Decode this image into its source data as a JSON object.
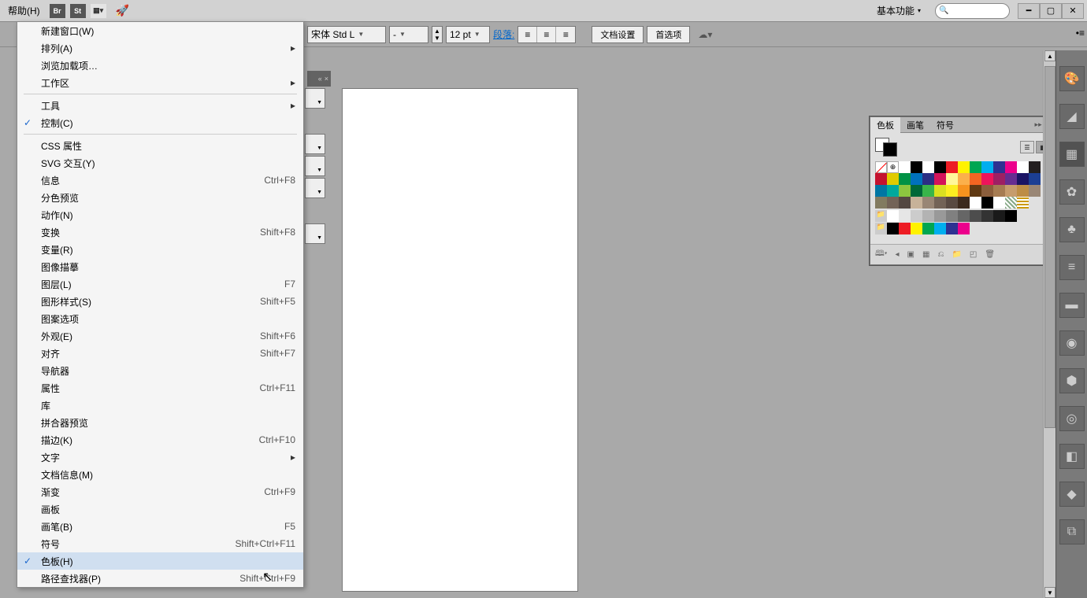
{
  "topbar": {
    "help": "帮助(H)",
    "workspace": "基本功能",
    "minimize": "━",
    "maximize": "▢",
    "close": "✕"
  },
  "options": {
    "font": "宋体 Std L",
    "fontStyle": "-",
    "size": "12 pt",
    "para": "段落:",
    "docSetup": "文档设置",
    "preferences": "首选项"
  },
  "menu": {
    "newWindow": "新建窗口(W)",
    "arrange": "排列(A)",
    "browseAddons": "浏览加载项…",
    "workspace": "工作区",
    "tools": "工具",
    "control": "控制(C)",
    "cssProps": "CSS 属性",
    "svgInteract": "SVG 交互(Y)",
    "info": "信息",
    "infoKey": "Ctrl+F8",
    "sepPrev": "分色预览",
    "actions": "动作(N)",
    "transform": "变换",
    "transformKey": "Shift+F8",
    "variables": "变量(R)",
    "imageTrace": "图像描摹",
    "layers": "图层(L)",
    "layersKey": "F7",
    "graphicStyles": "图形样式(S)",
    "graphicStylesKey": "Shift+F5",
    "patternOpts": "图案选项",
    "appearance": "外观(E)",
    "appearanceKey": "Shift+F6",
    "align": "对齐",
    "alignKey": "Shift+F7",
    "navigator": "导航器",
    "attributes": "属性",
    "attributesKey": "Ctrl+F11",
    "libraries": "库",
    "flattener": "拼合器预览",
    "stroke": "描边(K)",
    "strokeKey": "Ctrl+F10",
    "type": "文字",
    "docInfo": "文档信息(M)",
    "gradient": "渐变",
    "gradientKey": "Ctrl+F9",
    "artboards": "画板",
    "brushes": "画笔(B)",
    "brushesKey": "F5",
    "symbols": "符号",
    "symbolsKey": "Shift+Ctrl+F11",
    "swatches": "色板(H)",
    "pathfinder": "路径查找器(P)",
    "pathfinderKey": "Shift+Ctrl+F9"
  },
  "panel": {
    "tab1": "色板",
    "tab2": "画笔",
    "tab3": "符号"
  },
  "swatch_colors": [
    [
      "#ffffff",
      "#000000",
      "#ed1c24",
      "#fff200",
      "#00a651",
      "#00aeef",
      "#2e3192",
      "#ec008c",
      "#ffffff",
      "#231f20",
      "#c4122f",
      "#e0cb00",
      "#009245",
      "#0071bc",
      "#2b2f84",
      "#d4145a"
    ],
    [
      "#fff799",
      "#fbb04b",
      "#f26522",
      "#ed145b",
      "#9e1f63",
      "#662d91",
      "#1b1464",
      "#1c3f94",
      "#0076a3",
      "#00a99d",
      "#8cc63f",
      "#006838",
      "#39b54a",
      "#d9e021",
      "#fcee21",
      "#f7931e"
    ],
    [
      "#603913",
      "#8b5e3c",
      "#a67c52",
      "#c69c6d",
      "#bd8d46",
      "#998675",
      "#827b60",
      "#736357",
      "#534741",
      "#c7b299",
      "#998675",
      "#736357",
      "#594a42",
      "#3c2a1e",
      "#ffffff",
      "#000000"
    ]
  ],
  "grayscale": [
    "#ffffff",
    "#e6e6e6",
    "#cccccc",
    "#b3b3b3",
    "#999999",
    "#808080",
    "#666666",
    "#4d4d4d",
    "#333333",
    "#1a1a1a",
    "#000000"
  ],
  "group_colors": [
    "#000000",
    "#ed1c24",
    "#fff200",
    "#00a651",
    "#00aeef",
    "#2e3192",
    "#ec008c"
  ]
}
